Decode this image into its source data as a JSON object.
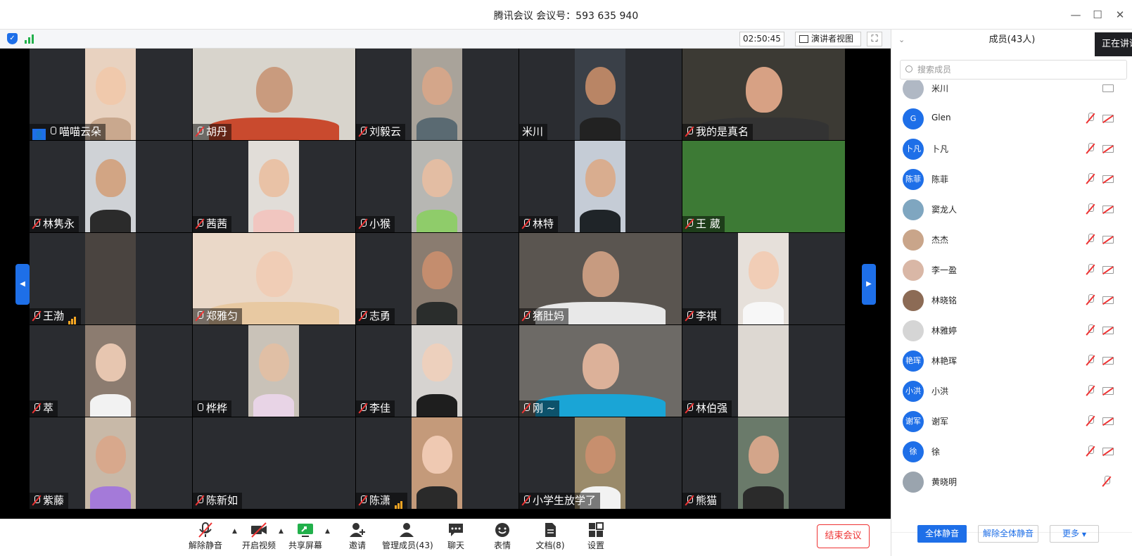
{
  "window": {
    "title": "腾讯会议 会议号：593 635 940"
  },
  "infobar": {
    "timer": "02:50:45",
    "speaker_view": "演讲者视图"
  },
  "participants": [
    {
      "name": "喵喵云朵",
      "mic": "on",
      "host": true
    },
    {
      "name": "胡丹",
      "mic": "muted"
    },
    {
      "name": "刘毅云",
      "mic": "muted"
    },
    {
      "name": "米川",
      "mic": "none"
    },
    {
      "name": "我的是真名",
      "mic": "muted"
    },
    {
      "name": "林隽永",
      "mic": "muted"
    },
    {
      "name": "茜茜",
      "mic": "muted"
    },
    {
      "name": "小猴",
      "mic": "muted"
    },
    {
      "name": "林特",
      "mic": "muted"
    },
    {
      "name": "王 葳",
      "mic": "muted"
    },
    {
      "name": "王渤",
      "mic": "muted",
      "signal": true
    },
    {
      "name": "郑雅匀",
      "mic": "muted"
    },
    {
      "name": "志勇",
      "mic": "muted"
    },
    {
      "name": "猪肚妈",
      "mic": "muted"
    },
    {
      "name": "李祺",
      "mic": "muted"
    },
    {
      "name": "萃",
      "mic": "muted"
    },
    {
      "name": "桦桦",
      "mic": "on"
    },
    {
      "name": "李佳",
      "mic": "muted"
    },
    {
      "name": "刚 ~",
      "mic": "muted"
    },
    {
      "name": "林伯强",
      "mic": "muted"
    },
    {
      "name": "紫藤",
      "mic": "muted"
    },
    {
      "name": "陈新如",
      "mic": "muted"
    },
    {
      "name": "陈潇",
      "mic": "muted",
      "signal": true
    },
    {
      "name": "小学生放学了",
      "mic": "muted"
    },
    {
      "name": "熊猫",
      "mic": "muted"
    }
  ],
  "toolbar": {
    "unmute": "解除静音",
    "video": "开启视频",
    "share": "共享屏幕",
    "invite": "邀请",
    "manage": "管理成员(43)",
    "chat": "聊天",
    "emoji": "表情",
    "docs": "文档(8)",
    "settings": "设置",
    "end": "结束会议"
  },
  "sidebar": {
    "title": "成员(43人)",
    "speaking_tip": "正在讲话",
    "search_placeholder": "搜索成员",
    "members": [
      {
        "name": "米川",
        "avatar_text": "",
        "avatar_color": "#b0b8c4",
        "mic": false,
        "cam": "on"
      },
      {
        "name": "Glen",
        "avatar_text": "G",
        "avatar_color": "#1e6fe8",
        "mic": true,
        "cam": "off"
      },
      {
        "name": "卜凡",
        "avatar_text": "卜凡",
        "avatar_color": "#1e6fe8",
        "mic": true,
        "cam": "off"
      },
      {
        "name": "陈菲",
        "avatar_text": "陈菲",
        "avatar_color": "#1e6fe8",
        "mic": true,
        "cam": "off"
      },
      {
        "name": "窦龙人",
        "avatar_text": "",
        "avatar_color": "#7fa6c0",
        "mic": true,
        "cam": "off"
      },
      {
        "name": "杰杰",
        "avatar_text": "",
        "avatar_color": "#c9a58a",
        "mic": true,
        "cam": "off"
      },
      {
        "name": "李一盈",
        "avatar_text": "",
        "avatar_color": "#d9b7a6",
        "mic": true,
        "cam": "off"
      },
      {
        "name": "林晓铭",
        "avatar_text": "",
        "avatar_color": "#8c6b55",
        "mic": true,
        "cam": "off"
      },
      {
        "name": "林雅婷",
        "avatar_text": "",
        "avatar_color": "#d5d5d5",
        "mic": true,
        "cam": "off"
      },
      {
        "name": "林艳珲",
        "avatar_text": "艳珲",
        "avatar_color": "#1e6fe8",
        "mic": true,
        "cam": "off"
      },
      {
        "name": "小洪",
        "avatar_text": "小洪",
        "avatar_color": "#1e6fe8",
        "mic": true,
        "cam": "off"
      },
      {
        "name": "谢军",
        "avatar_text": "谢军",
        "avatar_color": "#1e6fe8",
        "mic": true,
        "cam": "off"
      },
      {
        "name": "徐",
        "avatar_text": "徐",
        "avatar_color": "#1e6fe8",
        "mic": true,
        "cam": "off"
      },
      {
        "name": "黄晓明",
        "avatar_text": "",
        "avatar_color": "#9aa4ae",
        "mic": true,
        "cam": "none"
      }
    ],
    "mute_all": "全体静音",
    "unmute_all": "解除全体静音",
    "more": "更多"
  }
}
